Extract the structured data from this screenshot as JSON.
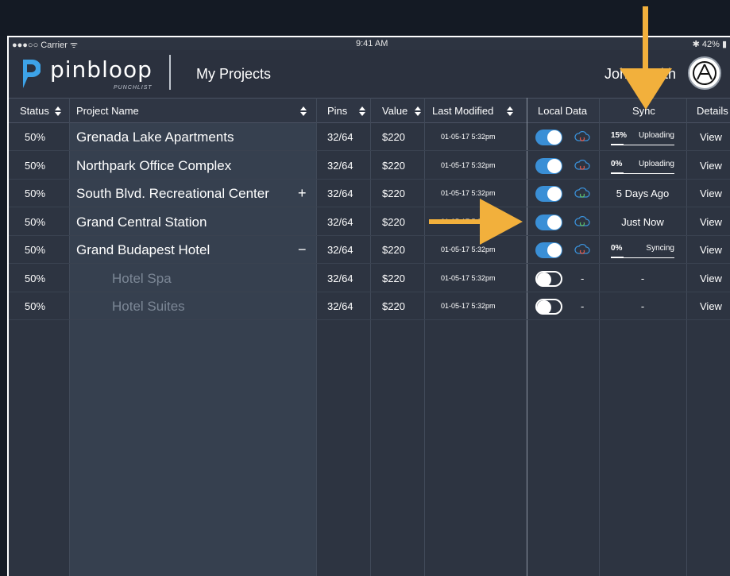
{
  "status_bar": {
    "carrier": "●●●○○ Carrier ᯤ",
    "time": "9:41 AM",
    "battery": "✱ 42% ▮"
  },
  "header": {
    "logo_word": "pinbloop",
    "logo_sub": "PUNCHLIST",
    "title": "My Projects",
    "user_name": "John Smith"
  },
  "columns": {
    "status": "Status",
    "project_name": "Project Name",
    "pins": "Pins",
    "value": "Value",
    "last_modified": "Last Modified",
    "local_data": "Local Data",
    "sync": "Sync",
    "details": "Details"
  },
  "rows": [
    {
      "status": "50%",
      "name": "Grenada Lake Apartments",
      "pins": "32/64",
      "value": "$220",
      "modified": "01-05-17  5:32pm",
      "local": true,
      "cloud": "red",
      "sync_pct": "15%",
      "sync_label": "Uploading",
      "sync_fill": 0.15,
      "details": "View"
    },
    {
      "status": "50%",
      "name": "Northpark Office Complex",
      "pins": "32/64",
      "value": "$220",
      "modified": "01-05-17  5:32pm",
      "local": true,
      "cloud": "red",
      "sync_pct": "0%",
      "sync_label": "Uploading",
      "sync_fill": 0.0,
      "details": "View"
    },
    {
      "status": "50%",
      "name": "South Blvd. Recreational Center",
      "expander": "+",
      "pins": "32/64",
      "value": "$220",
      "modified": "01-05-17  5:32pm",
      "local": true,
      "cloud": "green",
      "sync_text": "5 Days Ago",
      "details": "View"
    },
    {
      "status": "50%",
      "name": "Grand Central Station",
      "pins": "32/64",
      "value": "$220",
      "modified": "01-05-17  5:32pm",
      "local": true,
      "cloud": "green",
      "sync_text": "Just Now",
      "details": "View"
    },
    {
      "status": "50%",
      "name": "Grand Budapest Hotel",
      "expander": "−",
      "pins": "32/64",
      "value": "$220",
      "modified": "01-05-17  5:32pm",
      "local": true,
      "cloud": "red",
      "sync_pct": "0%",
      "sync_label": "Syncing",
      "sync_fill": 0.0,
      "details": "View"
    },
    {
      "status": "50%",
      "name": "Hotel Spa",
      "child": true,
      "pins": "32/64",
      "value": "$220",
      "modified": "01-05-17  5:32pm",
      "local": false,
      "local_dash": "-",
      "sync_text": "-",
      "details": "View"
    },
    {
      "status": "50%",
      "name": "Hotel Suites",
      "child": true,
      "pins": "32/64",
      "value": "$220",
      "modified": "01-05-17  5:32pm",
      "local": false,
      "local_dash": "-",
      "sync_text": "-",
      "details": "View"
    }
  ],
  "colors": {
    "accent": "#3a8fd6",
    "arrow": "#f2b03c",
    "cloud_red": "#e05a4a",
    "cloud_green": "#5fbf6a"
  }
}
